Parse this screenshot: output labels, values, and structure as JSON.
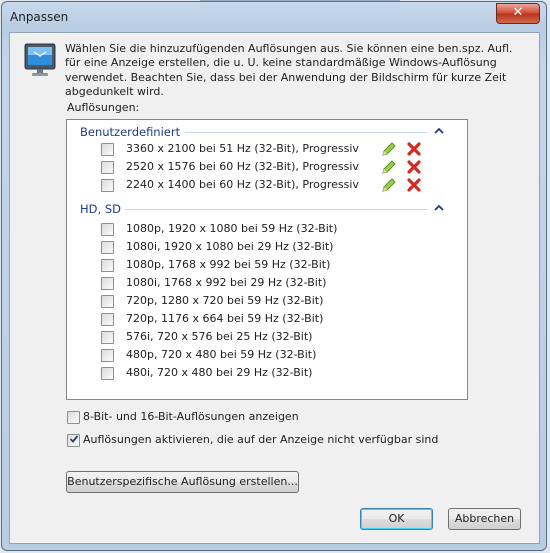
{
  "window": {
    "title": "Anpassen",
    "close_label": "✕"
  },
  "intro_text": "Wählen Sie die hinzuzufügenden Auflösungen aus. Sie können eine ben.spz. Aufl. für eine Anzeige erstellen, die u. U. keine standardmäßige Windows-Auflösung verwendet. Beachten Sie, dass bei der Anwendung der Bildschirm für kurze Zeit abgedunkelt wird.",
  "resolutions_label": "Auflösungen:",
  "groups": [
    {
      "title": "Benutzerdefiniert",
      "items": [
        {
          "label": "3360 x 2100 bei 51 Hz (32-Bit), Progressiv",
          "checked": false
        },
        {
          "label": "2520 x 1576 bei 60 Hz (32-Bit), Progressiv",
          "checked": false
        },
        {
          "label": "2240 x 1400 bei 60 Hz (32-Bit), Progressiv",
          "checked": false
        }
      ]
    },
    {
      "title": "HD, SD",
      "items": [
        {
          "label": "1080p, 1920 x 1080 bei 59 Hz (32-Bit)",
          "checked": false
        },
        {
          "label": "1080i, 1920 x 1080 bei 29 Hz (32-Bit)",
          "checked": false
        },
        {
          "label": "1080p, 1768 x 992 bei 59 Hz (32-Bit)",
          "checked": false
        },
        {
          "label": "1080i, 1768 x 992 bei 29 Hz (32-Bit)",
          "checked": false
        },
        {
          "label": "720p, 1280 x 720 bei 59 Hz (32-Bit)",
          "checked": false
        },
        {
          "label": "720p, 1176 x 664 bei 59 Hz (32-Bit)",
          "checked": false
        },
        {
          "label": "576i, 720 x 576 bei 25 Hz (32-Bit)",
          "checked": false
        },
        {
          "label": "480p, 720 x 480 bei 59 Hz (32-Bit)",
          "checked": false
        },
        {
          "label": "480i, 720 x 480 bei 29 Hz (32-Bit)",
          "checked": false
        }
      ]
    }
  ],
  "options": [
    {
      "label": "8-Bit- und 16-Bit-Auflösungen anzeigen",
      "checked": false
    },
    {
      "label": "Auflösungen aktivieren, die auf der Anzeige nicht verfügbar sind",
      "checked": true
    }
  ],
  "buttons": {
    "create_custom": "Benutzerspezifische Auflösung erstellen...",
    "ok": "OK",
    "cancel": "Abbrechen"
  },
  "colors": {
    "group_header": "#1f3c86",
    "delete": "#d42a1f",
    "edit": "#7cbc2b"
  }
}
